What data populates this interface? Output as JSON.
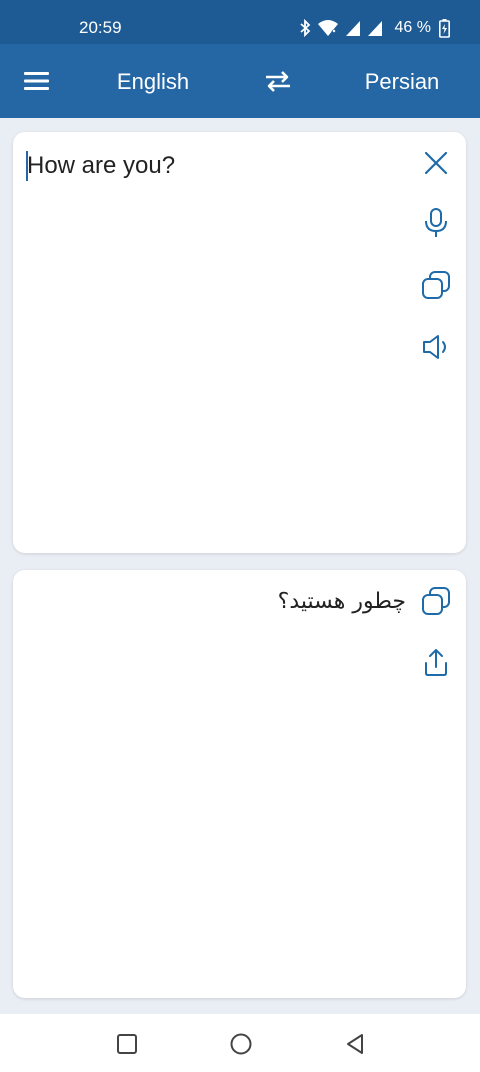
{
  "status_bar": {
    "time": "20:59",
    "battery_percent": "46 %"
  },
  "app_bar": {
    "source_language": "English",
    "target_language": "Persian"
  },
  "input_card": {
    "text": "How are you?"
  },
  "output_card": {
    "text": "چطور هستید؟"
  },
  "colors": {
    "primary": "#2467a4",
    "status_bar": "#1e5a94",
    "background": "#e9eef4",
    "icon_accent": "#1f6aa8"
  },
  "icons": {
    "menu": "hamburger-icon",
    "swap": "swap-arrows-icon",
    "clear": "close-icon",
    "mic": "microphone-icon",
    "copy": "copy-icon",
    "speak": "speaker-icon",
    "share": "share-icon"
  }
}
